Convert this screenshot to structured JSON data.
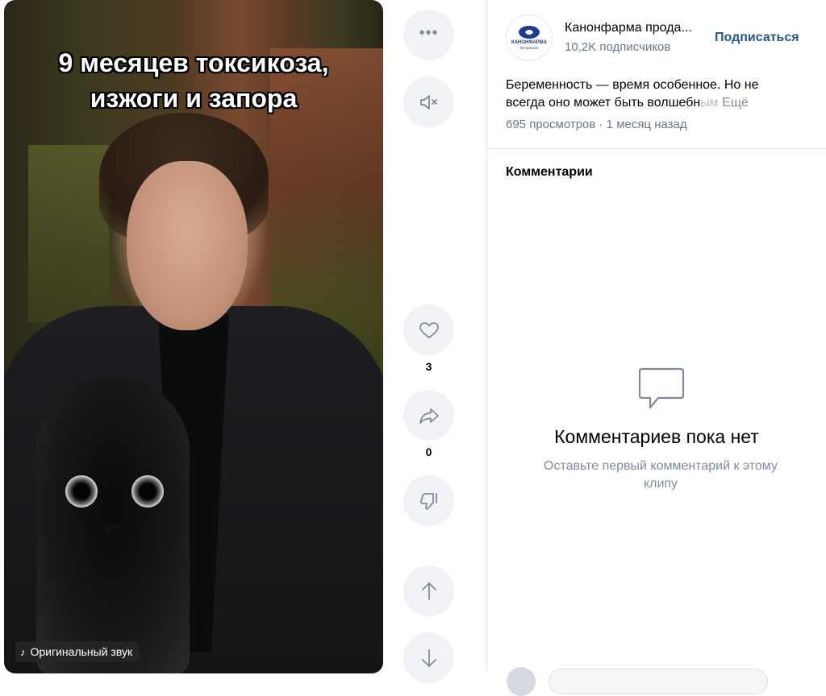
{
  "video": {
    "caption_lines": [
      "9 месяцев токсикоза,",
      "изжоги и запора"
    ],
    "sound_label": "Оригинальный звук"
  },
  "actions": {
    "more_icon": "more-horizontal-icon",
    "mute_icon": "volume-muted-icon",
    "like_icon": "heart-icon",
    "like_count": "3",
    "share_icon": "share-arrow-icon",
    "share_count": "0",
    "dislike_icon": "thumbs-down-icon",
    "prev_icon": "arrow-up-icon",
    "next_icon": "arrow-down-icon"
  },
  "channel": {
    "name": "Канонфарма прода...",
    "subscribers": "10,2K подписчиков",
    "subscribe_label": "Подписаться",
    "logo_text": "КАНОНФАРМА",
    "logo_sub": "продакшн"
  },
  "post": {
    "description_line1": "Беременность — время особенное. Но не",
    "description_line2_visible": "всегда оно может быть волшебн",
    "description_line2_faded": "ым",
    "more_label": "Ещё",
    "meta": "695 просмотров · 1 месяц назад"
  },
  "comments": {
    "title": "Комментарии",
    "empty_icon": "comment-bubble-icon",
    "empty_title": "Комментариев пока нет",
    "empty_subtitle": "Оставьте первый комментарий к этому клипу"
  },
  "colors": {
    "accent": "#2a5885",
    "secondary_text": "#6d7885",
    "button_bg": "#f0f2f5",
    "icon_gray": "#818c99"
  }
}
